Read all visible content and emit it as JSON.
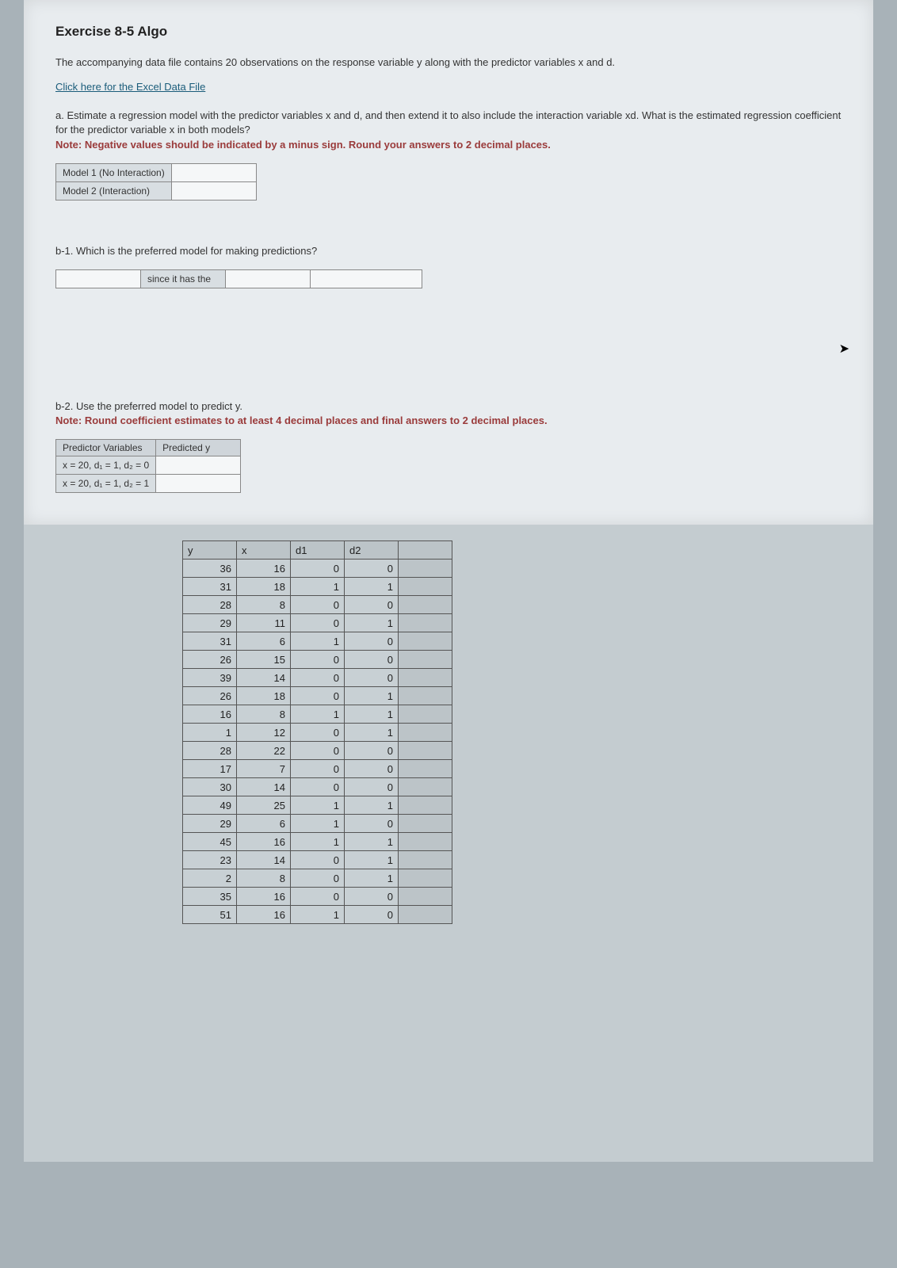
{
  "title": "Exercise 8-5 Algo",
  "intro": "The accompanying data file contains 20 observations on the response variable y along with the predictor variables x and d.",
  "link_text": "Click here for the Excel Data File",
  "part_a": {
    "prompt": "a. Estimate a regression model with the predictor variables x and d, and then extend it to also include the interaction variable xd. What is the estimated regression coefficient for the predictor variable x in both models?",
    "note": "Note: Negative values should be indicated by a minus sign. Round your answers to 2 decimal places.",
    "rows": [
      "Model 1 (No Interaction)",
      "Model 2 (Interaction)"
    ]
  },
  "part_b1": {
    "prompt": "b-1. Which is the preferred model for making predictions?",
    "mid_text": "since it has the"
  },
  "part_b2": {
    "prompt": "b-2. Use the preferred model to predict y.",
    "note": "Note: Round coefficient estimates to at least 4 decimal places and final answers to 2 decimal places.",
    "header1": "Predictor Variables",
    "header2": "Predicted y",
    "rows": [
      "x = 20, d₁ = 1, d₂ = 0",
      "x = 20, d₁ = 1, d₂ = 1"
    ]
  },
  "data_headers": [
    "y",
    "x",
    "d1",
    "d2"
  ],
  "data_rows": [
    [
      36,
      16,
      0,
      0
    ],
    [
      31,
      18,
      1,
      1
    ],
    [
      28,
      8,
      0,
      0
    ],
    [
      29,
      11,
      0,
      1
    ],
    [
      31,
      6,
      1,
      0
    ],
    [
      26,
      15,
      0,
      0
    ],
    [
      39,
      14,
      0,
      0
    ],
    [
      26,
      18,
      0,
      1
    ],
    [
      16,
      8,
      1,
      1
    ],
    [
      1,
      12,
      0,
      1
    ],
    [
      28,
      22,
      0,
      0
    ],
    [
      17,
      7,
      0,
      0
    ],
    [
      30,
      14,
      0,
      0
    ],
    [
      49,
      25,
      1,
      1
    ],
    [
      29,
      6,
      1,
      0
    ],
    [
      45,
      16,
      1,
      1
    ],
    [
      23,
      14,
      0,
      1
    ],
    [
      2,
      8,
      0,
      1
    ],
    [
      35,
      16,
      0,
      0
    ],
    [
      51,
      16,
      1,
      0
    ]
  ]
}
